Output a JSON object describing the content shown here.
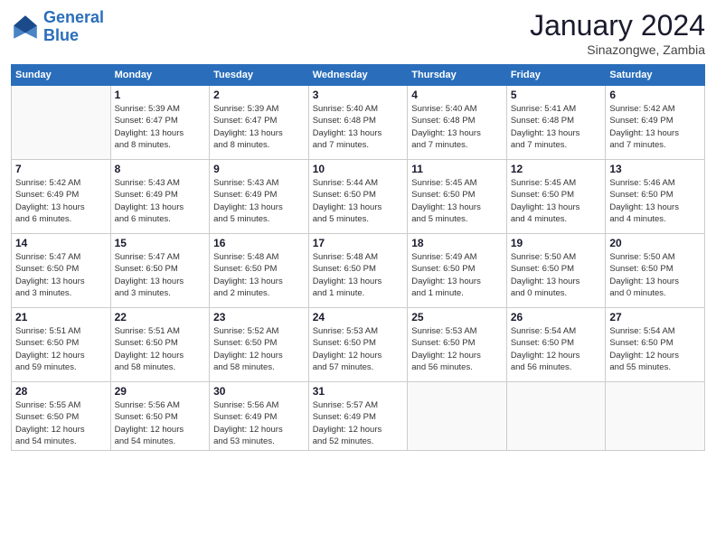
{
  "header": {
    "logo_line1": "General",
    "logo_line2": "Blue",
    "month": "January 2024",
    "location": "Sinazongwe, Zambia"
  },
  "weekdays": [
    "Sunday",
    "Monday",
    "Tuesday",
    "Wednesday",
    "Thursday",
    "Friday",
    "Saturday"
  ],
  "weeks": [
    [
      {
        "day": "",
        "info": ""
      },
      {
        "day": "1",
        "info": "Sunrise: 5:39 AM\nSunset: 6:47 PM\nDaylight: 13 hours\nand 8 minutes."
      },
      {
        "day": "2",
        "info": "Sunrise: 5:39 AM\nSunset: 6:47 PM\nDaylight: 13 hours\nand 8 minutes."
      },
      {
        "day": "3",
        "info": "Sunrise: 5:40 AM\nSunset: 6:48 PM\nDaylight: 13 hours\nand 7 minutes."
      },
      {
        "day": "4",
        "info": "Sunrise: 5:40 AM\nSunset: 6:48 PM\nDaylight: 13 hours\nand 7 minutes."
      },
      {
        "day": "5",
        "info": "Sunrise: 5:41 AM\nSunset: 6:48 PM\nDaylight: 13 hours\nand 7 minutes."
      },
      {
        "day": "6",
        "info": "Sunrise: 5:42 AM\nSunset: 6:49 PM\nDaylight: 13 hours\nand 7 minutes."
      }
    ],
    [
      {
        "day": "7",
        "info": "Sunrise: 5:42 AM\nSunset: 6:49 PM\nDaylight: 13 hours\nand 6 minutes."
      },
      {
        "day": "8",
        "info": "Sunrise: 5:43 AM\nSunset: 6:49 PM\nDaylight: 13 hours\nand 6 minutes."
      },
      {
        "day": "9",
        "info": "Sunrise: 5:43 AM\nSunset: 6:49 PM\nDaylight: 13 hours\nand 5 minutes."
      },
      {
        "day": "10",
        "info": "Sunrise: 5:44 AM\nSunset: 6:50 PM\nDaylight: 13 hours\nand 5 minutes."
      },
      {
        "day": "11",
        "info": "Sunrise: 5:45 AM\nSunset: 6:50 PM\nDaylight: 13 hours\nand 5 minutes."
      },
      {
        "day": "12",
        "info": "Sunrise: 5:45 AM\nSunset: 6:50 PM\nDaylight: 13 hours\nand 4 minutes."
      },
      {
        "day": "13",
        "info": "Sunrise: 5:46 AM\nSunset: 6:50 PM\nDaylight: 13 hours\nand 4 minutes."
      }
    ],
    [
      {
        "day": "14",
        "info": "Sunrise: 5:47 AM\nSunset: 6:50 PM\nDaylight: 13 hours\nand 3 minutes."
      },
      {
        "day": "15",
        "info": "Sunrise: 5:47 AM\nSunset: 6:50 PM\nDaylight: 13 hours\nand 3 minutes."
      },
      {
        "day": "16",
        "info": "Sunrise: 5:48 AM\nSunset: 6:50 PM\nDaylight: 13 hours\nand 2 minutes."
      },
      {
        "day": "17",
        "info": "Sunrise: 5:48 AM\nSunset: 6:50 PM\nDaylight: 13 hours\nand 1 minute."
      },
      {
        "day": "18",
        "info": "Sunrise: 5:49 AM\nSunset: 6:50 PM\nDaylight: 13 hours\nand 1 minute."
      },
      {
        "day": "19",
        "info": "Sunrise: 5:50 AM\nSunset: 6:50 PM\nDaylight: 13 hours\nand 0 minutes."
      },
      {
        "day": "20",
        "info": "Sunrise: 5:50 AM\nSunset: 6:50 PM\nDaylight: 13 hours\nand 0 minutes."
      }
    ],
    [
      {
        "day": "21",
        "info": "Sunrise: 5:51 AM\nSunset: 6:50 PM\nDaylight: 12 hours\nand 59 minutes."
      },
      {
        "day": "22",
        "info": "Sunrise: 5:51 AM\nSunset: 6:50 PM\nDaylight: 12 hours\nand 58 minutes."
      },
      {
        "day": "23",
        "info": "Sunrise: 5:52 AM\nSunset: 6:50 PM\nDaylight: 12 hours\nand 58 minutes."
      },
      {
        "day": "24",
        "info": "Sunrise: 5:53 AM\nSunset: 6:50 PM\nDaylight: 12 hours\nand 57 minutes."
      },
      {
        "day": "25",
        "info": "Sunrise: 5:53 AM\nSunset: 6:50 PM\nDaylight: 12 hours\nand 56 minutes."
      },
      {
        "day": "26",
        "info": "Sunrise: 5:54 AM\nSunset: 6:50 PM\nDaylight: 12 hours\nand 56 minutes."
      },
      {
        "day": "27",
        "info": "Sunrise: 5:54 AM\nSunset: 6:50 PM\nDaylight: 12 hours\nand 55 minutes."
      }
    ],
    [
      {
        "day": "28",
        "info": "Sunrise: 5:55 AM\nSunset: 6:50 PM\nDaylight: 12 hours\nand 54 minutes."
      },
      {
        "day": "29",
        "info": "Sunrise: 5:56 AM\nSunset: 6:50 PM\nDaylight: 12 hours\nand 54 minutes."
      },
      {
        "day": "30",
        "info": "Sunrise: 5:56 AM\nSunset: 6:49 PM\nDaylight: 12 hours\nand 53 minutes."
      },
      {
        "day": "31",
        "info": "Sunrise: 5:57 AM\nSunset: 6:49 PM\nDaylight: 12 hours\nand 52 minutes."
      },
      {
        "day": "",
        "info": ""
      },
      {
        "day": "",
        "info": ""
      },
      {
        "day": "",
        "info": ""
      }
    ]
  ]
}
